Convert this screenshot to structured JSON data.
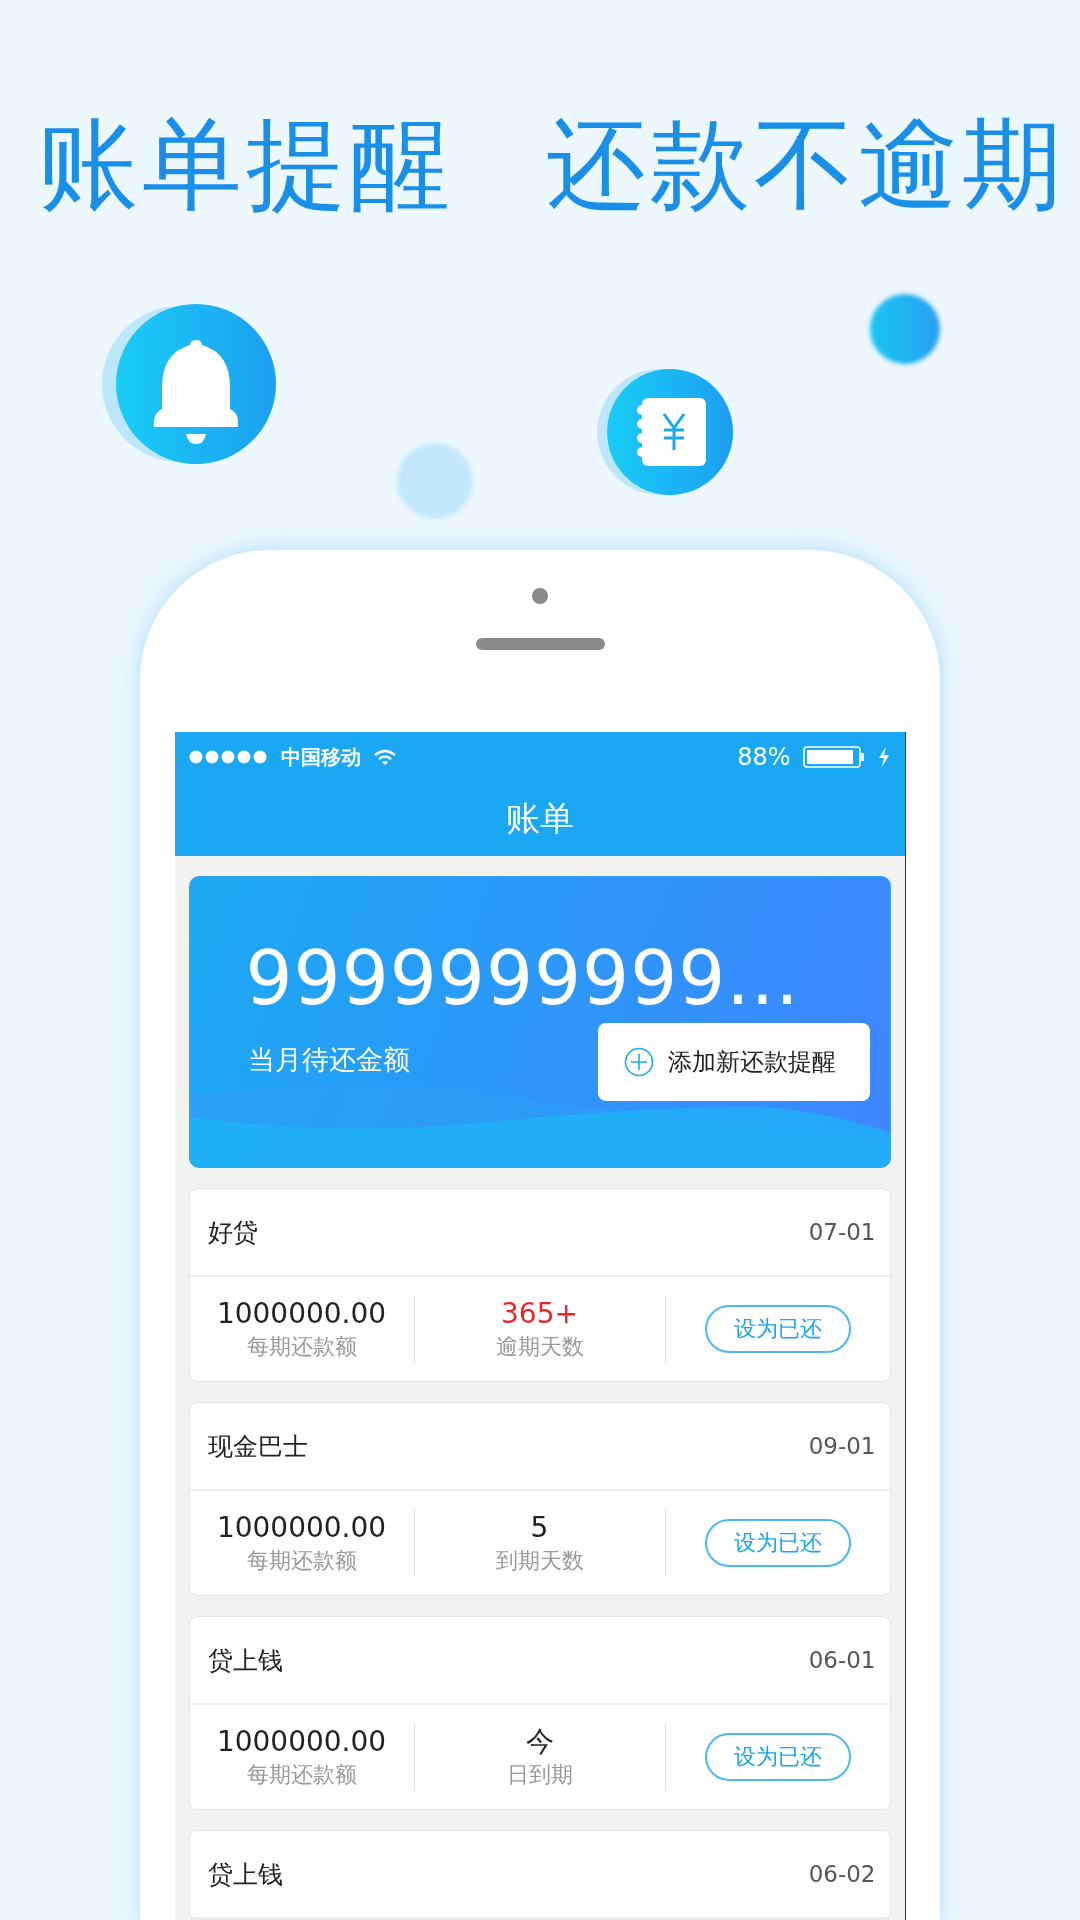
{
  "headline": [
    "账单提醒",
    "还款不逾期"
  ],
  "status_bar": {
    "carrier": "中国移动",
    "battery": "88%"
  },
  "nav": {
    "title": "账单"
  },
  "summary": {
    "amount": "9999999999...",
    "label": "当月待还金额",
    "add_button": "添加新还款提醒"
  },
  "bills": [
    {
      "name": "好贷",
      "date": "07-01",
      "amount": "1000000.00",
      "amount_label": "每期还款额",
      "days": "365+",
      "days_label": "逾期天数",
      "overdue": true,
      "button": "设为已还"
    },
    {
      "name": "现金巴士",
      "date": "09-01",
      "amount": "1000000.00",
      "amount_label": "每期还款额",
      "days": "5",
      "days_label": "到期天数",
      "overdue": false,
      "button": "设为已还"
    },
    {
      "name": "贷上钱",
      "date": "06-01",
      "amount": "1000000.00",
      "amount_label": "每期还款额",
      "days": "今",
      "days_label": "日到期",
      "overdue": false,
      "button": "设为已还"
    },
    {
      "name": "贷上钱",
      "date": "06-02"
    }
  ]
}
